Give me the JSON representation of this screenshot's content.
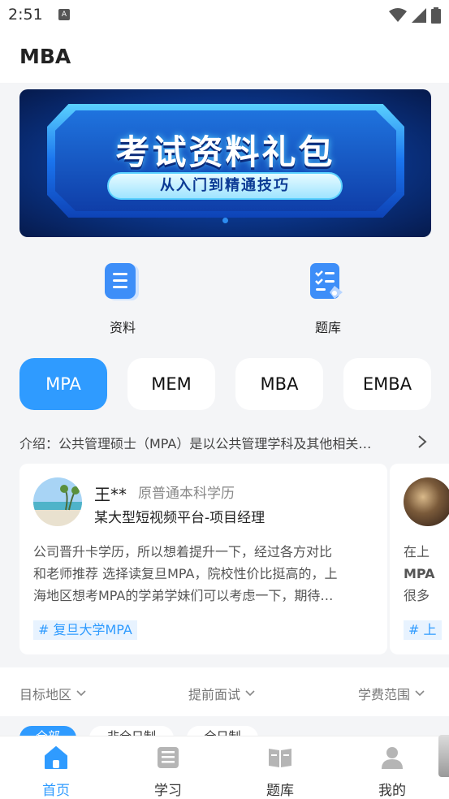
{
  "status_bar": {
    "time": "2:51",
    "notification_glyph": "A"
  },
  "header": {
    "title": "MBA"
  },
  "banner": {
    "title": "考试资料礼包",
    "subtitle": "从入门到精通技巧"
  },
  "quick_links": [
    {
      "label": "资料",
      "icon": "document-list-icon"
    },
    {
      "label": "题库",
      "icon": "checklist-icon"
    }
  ],
  "program_tabs": [
    {
      "label": "MPA",
      "active": true
    },
    {
      "label": "MEM",
      "active": false
    },
    {
      "label": "MBA",
      "active": false
    },
    {
      "label": "EMBA",
      "active": false
    }
  ],
  "intro": {
    "text": "介绍：公共管理硕士（MPA）是以公共管理学科及其他相关…"
  },
  "reviews": [
    {
      "name": "王**",
      "education": "原普通本科学历",
      "job": "某大型短视频平台-项目经理",
      "body_lines": [
        "公司晋升卡学历，所以想着提升一下，经过各方对比",
        "和老师推荐 选择读复旦MPA，院校性价比挺高的，上",
        "海地区想考MPA的学弟学妹们可以考虑一下，期待…"
      ],
      "tag": "# 复旦大学MPA"
    },
    {
      "body_lines": [
        "在上",
        "MPA",
        "很多"
      ],
      "tag": "# 上"
    }
  ],
  "filters": [
    {
      "label": "目标地区"
    },
    {
      "label": "提前面试"
    },
    {
      "label": "学费范围"
    }
  ],
  "chips": [
    {
      "label": "全部",
      "active": true
    },
    {
      "label": "非全日制",
      "active": false
    },
    {
      "label": "全日制",
      "active": false
    }
  ],
  "bottom_nav": [
    {
      "label": "首页",
      "active": true
    },
    {
      "label": "学习",
      "active": false
    },
    {
      "label": "题库",
      "active": false
    },
    {
      "label": "我的",
      "active": false
    }
  ],
  "colors": {
    "accent": "#2f9bff",
    "page_bg": "#f4f5f7",
    "tag_bg": "#e8f3ff"
  }
}
